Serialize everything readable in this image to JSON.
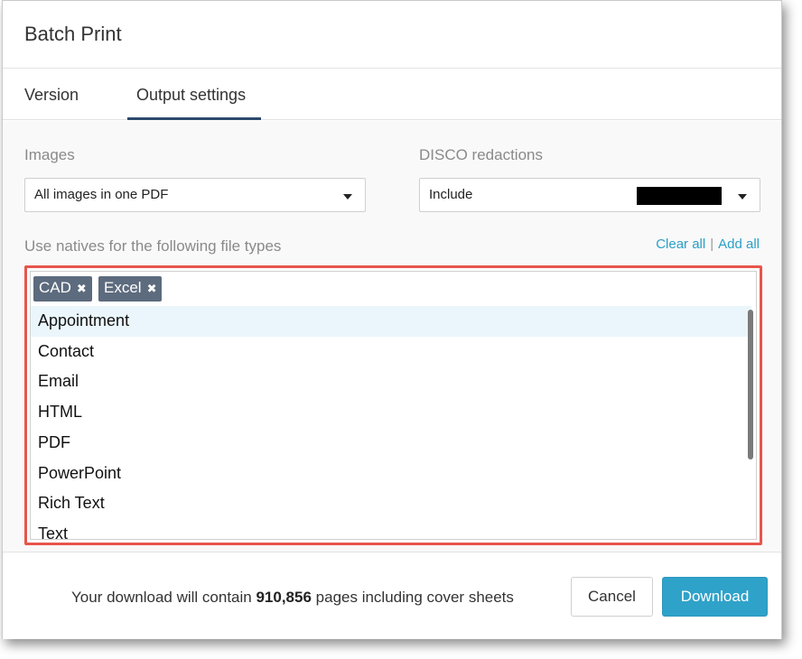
{
  "dialog": {
    "title": "Batch Print"
  },
  "tabs": [
    {
      "label": "Version",
      "active": false
    },
    {
      "label": "Output settings",
      "active": true
    }
  ],
  "images": {
    "label": "Images",
    "value": "All images in one PDF"
  },
  "disco": {
    "label": "DISCO redactions",
    "value": "Include"
  },
  "natives": {
    "label": "Use natives for the following file types",
    "clear_all": "Clear all",
    "separator": "|",
    "add_all": "Add all",
    "selected": [
      "CAD",
      "Excel"
    ],
    "remove_glyph": "✖",
    "options": [
      "Appointment",
      "Contact",
      "Email",
      "HTML",
      "PDF",
      "PowerPoint",
      "Rich Text",
      "Text"
    ]
  },
  "footer": {
    "summary_prefix": "Your download will contain",
    "page_count": "910,856",
    "summary_suffix": "pages including cover sheets",
    "cancel_label": "Cancel",
    "download_label": "Download"
  },
  "colors": {
    "accent": "#2fa2c9",
    "highlight_border": "#e8554b",
    "tab_underline": "#2b4a6b",
    "chip_bg": "#5d6b7e"
  }
}
